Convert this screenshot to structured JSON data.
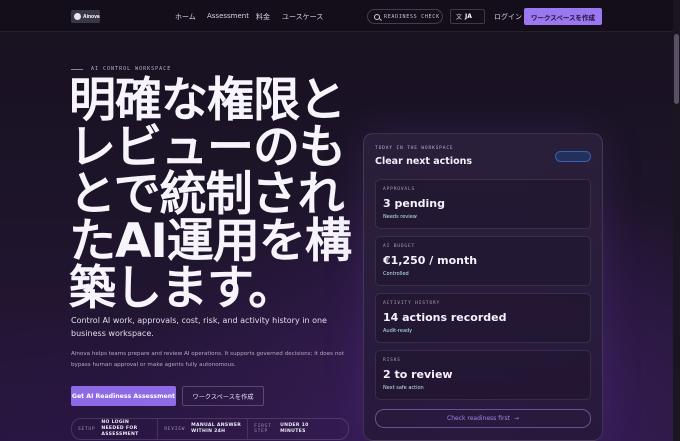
{
  "nav": {
    "logo_text": "Ainova",
    "links": [
      "ホーム",
      "Assessment",
      "料金",
      "ユースケース"
    ],
    "search_label": "READINESS CHECK",
    "lang_label": "JA",
    "login": "ログイン",
    "cta": "ワークスペースを作成"
  },
  "hero": {
    "eyebrow": "AI CONTROL WORKSPACE",
    "headline": "明確な権限とレビューのもとで統制されたAI運用を構築します。",
    "lead": "Control AI work, approvals, cost, risk, and activity history in one business workspace.",
    "sub": "Ainova helps teams prepare and review AI operations. It supports governed decisions; it does not bypass human approval or make agents fully autonomous.",
    "primary_button": "Get AI Readiness Assessment",
    "secondary_button": "ワークスペースを作成",
    "facts": [
      {
        "key": "SETUP",
        "value": "NO LOGIN NEEDED FOR ASSESSMENT"
      },
      {
        "key": "REVIEW",
        "value": "MANUAL ANSWER WITHIN 24H"
      },
      {
        "key": "FIRST STEP",
        "value": "UNDER 10 MINUTES"
      }
    ]
  },
  "panel": {
    "eyebrow": "TODAY IN THE WORKSPACE",
    "title": "Clear next actions",
    "cards": [
      {
        "key": "APPROVALS",
        "value": "3 pending",
        "status": "Needs review"
      },
      {
        "key": "AI BUDGET",
        "value": "€1,250 / month",
        "status": "Controlled"
      },
      {
        "key": "ACTIVITY HISTORY",
        "value": "14 actions recorded",
        "status": "Audit-ready"
      },
      {
        "key": "RISKS",
        "value": "2 to review",
        "status": "Next safe action"
      }
    ],
    "cta": "Check readiness first",
    "cta_arrow": "→"
  },
  "colors": {
    "accent": "#9b78f0",
    "status_text": "#b6e8f0"
  }
}
